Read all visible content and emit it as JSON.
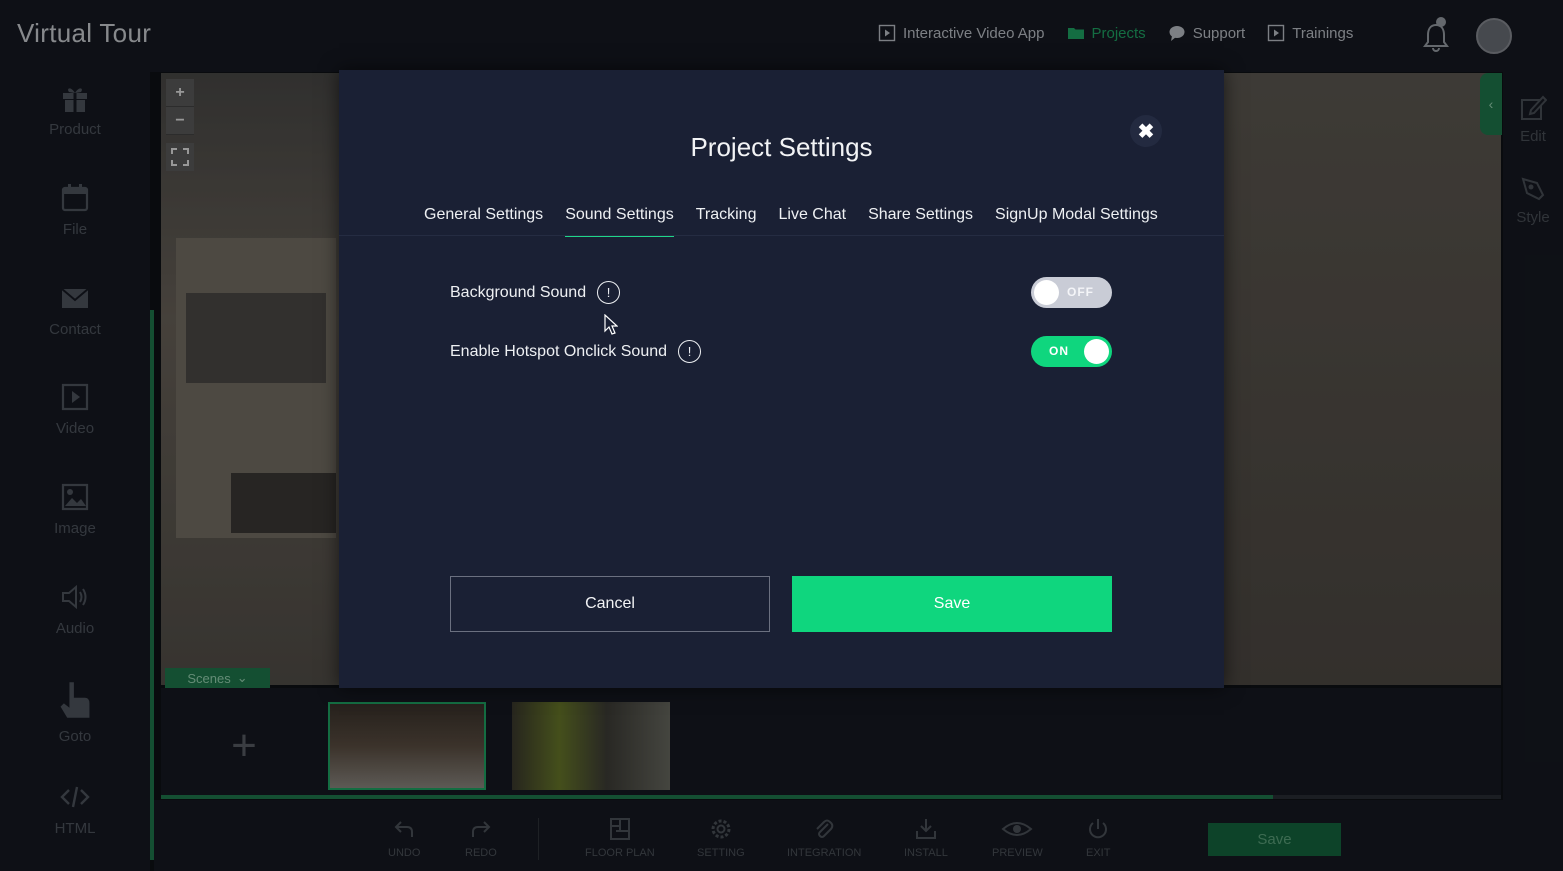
{
  "app": {
    "title": "Virtual Tour"
  },
  "topnav": [
    {
      "label": "Interactive Video App",
      "icon": "play-square-icon",
      "active": false
    },
    {
      "label": "Projects",
      "icon": "folder-icon",
      "active": true
    },
    {
      "label": "Support",
      "icon": "chat-bubble-icon",
      "active": false
    },
    {
      "label": "Trainings",
      "icon": "play-square-icon",
      "active": false
    }
  ],
  "sidebar": {
    "items": [
      {
        "label": "Product",
        "icon": "gift-icon"
      },
      {
        "label": "File",
        "icon": "calendar-icon"
      },
      {
        "label": "Contact",
        "icon": "envelope-icon"
      },
      {
        "label": "Video",
        "icon": "video-icon"
      },
      {
        "label": "Image",
        "icon": "image-icon"
      },
      {
        "label": "Audio",
        "icon": "speaker-icon"
      },
      {
        "label": "Goto",
        "icon": "hand-pointer-icon"
      },
      {
        "label": "HTML",
        "icon": "code-icon"
      }
    ]
  },
  "viewer": {
    "zoom_in": "+",
    "zoom_out": "−",
    "scenes_tab": "Scenes"
  },
  "rightpanel": {
    "items": [
      {
        "label": "Edit",
        "icon": "edit-icon"
      },
      {
        "label": "Style",
        "icon": "style-icon"
      }
    ]
  },
  "scenes": {
    "progress": 0.83
  },
  "toolbar": {
    "items": [
      {
        "label": "UNDO",
        "icon": "undo-icon"
      },
      {
        "label": "REDO",
        "icon": "redo-icon"
      },
      {
        "label": "FLOOR PLAN",
        "icon": "floor-plan-icon"
      },
      {
        "label": "SETTING",
        "icon": "gear-icon"
      },
      {
        "label": "INTEGRATION",
        "icon": "paperclip-icon"
      },
      {
        "label": "INSTALL",
        "icon": "download-icon"
      },
      {
        "label": "PREVIEW",
        "icon": "eye-icon"
      },
      {
        "label": "EXIT",
        "icon": "power-icon"
      }
    ],
    "save_label": "Save"
  },
  "modal": {
    "title": "Project Settings",
    "close": "✖",
    "tabs": [
      {
        "label": "General Settings",
        "active": false
      },
      {
        "label": "Sound Settings",
        "active": true
      },
      {
        "label": "Tracking",
        "active": false
      },
      {
        "label": "Live Chat",
        "active": false
      },
      {
        "label": "Share Settings",
        "active": false
      },
      {
        "label": "SignUp Modal Settings",
        "active": false
      }
    ],
    "settings": [
      {
        "label": "Background Sound",
        "state": "OFF",
        "enabled": false
      },
      {
        "label": "Enable Hotspot Onclick Sound",
        "state": "ON",
        "enabled": true
      }
    ],
    "info_glyph": "!",
    "cancel_label": "Cancel",
    "save_label": "Save"
  },
  "colors": {
    "accent": "#0fd67e",
    "active_nav": "#1fa866",
    "modal_bg": "#1a2034"
  }
}
